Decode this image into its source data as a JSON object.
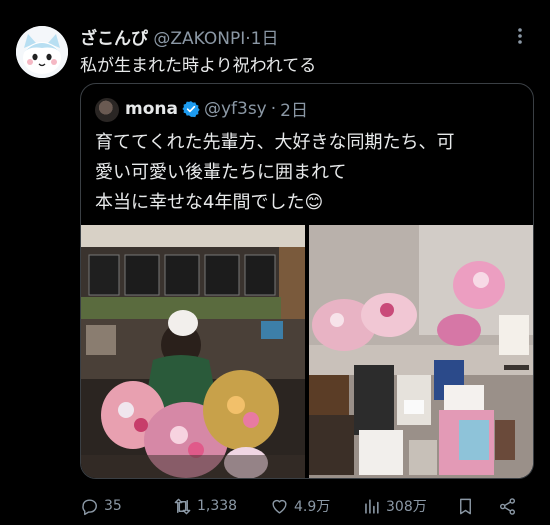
{
  "tweet": {
    "author_name": "ざこんぴ",
    "author_handle": "@ZAKONPI",
    "separator": "·",
    "time": "1日",
    "text": "私が生まれた時より祝われてる"
  },
  "quoted_tweet": {
    "author_name": "mona",
    "author_handle": "@yf3sy",
    "separator": "·",
    "time": "2日",
    "text_lines": [
      "育ててくれた先輩方、大好きな同期たち、可",
      "愛い可愛い後輩たちに囲まれて",
      "本当に幸せな4年間でした😊"
    ]
  },
  "actions": {
    "replies": "35",
    "retweets": "1,338",
    "likes": "4.9万",
    "views": "308万"
  },
  "colors": {
    "background": "#000000",
    "text": "#e7e9ea",
    "secondary": "#8b98a5",
    "verified": "#1d9bf0"
  },
  "icons": [
    "more-icon",
    "verified-badge-icon",
    "reply-icon",
    "retweet-icon",
    "like-icon",
    "views-icon",
    "bookmark-icon",
    "share-icon"
  ]
}
